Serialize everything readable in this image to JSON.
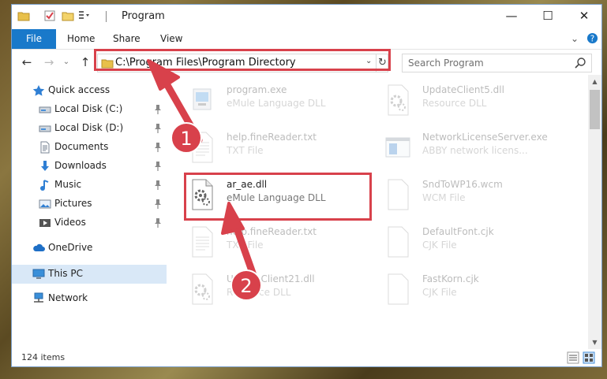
{
  "window": {
    "title": "Program",
    "controls": {
      "minimize": "—",
      "maximize": "☐",
      "close": "✕"
    }
  },
  "ribbon": {
    "tabs": [
      {
        "label": "File"
      },
      {
        "label": "Home"
      },
      {
        "label": "Share"
      },
      {
        "label": "View"
      }
    ],
    "expand_icon": "chevron-down-icon",
    "help_icon": "help-icon"
  },
  "navigation": {
    "back": "←",
    "forward": "→",
    "recent": "⌄",
    "up": "↑",
    "address": "C:\\Program Files\\Program Directory",
    "address_dropdown": "⌄",
    "refresh": "↻",
    "search_placeholder": "Search Program"
  },
  "sidebar": {
    "items": [
      {
        "label": "Quick access",
        "icon": "star-icon"
      },
      {
        "label": "Local Disk (C:)",
        "icon": "drive-icon",
        "pinned": true
      },
      {
        "label": "Local Disk (D:)",
        "icon": "drive-icon",
        "pinned": true
      },
      {
        "label": "Documents",
        "icon": "documents-icon",
        "pinned": true
      },
      {
        "label": "Downloads",
        "icon": "download-icon",
        "pinned": true
      },
      {
        "label": "Music",
        "icon": "music-icon",
        "pinned": true
      },
      {
        "label": "Pictures",
        "icon": "pictures-icon",
        "pinned": true
      },
      {
        "label": "Videos",
        "icon": "videos-icon",
        "pinned": true
      },
      {
        "label": "OneDrive",
        "icon": "cloud-icon"
      },
      {
        "label": "This PC",
        "icon": "computer-icon",
        "selected": true
      },
      {
        "label": "Network",
        "icon": "network-icon"
      }
    ]
  },
  "files": [
    {
      "name": "program.exe",
      "desc": "eMule Language DLL",
      "icon": "exe-icon"
    },
    {
      "name": "UpdateClient5.dll",
      "desc": "Resource DLL",
      "icon": "gear-file-icon"
    },
    {
      "name": "help.fineReader.txt",
      "desc": "TXT File",
      "icon": "text-file-icon"
    },
    {
      "name": "NetworkLicenseServer.exe",
      "desc": "ABBY network licens...",
      "icon": "window-file-icon"
    },
    {
      "name": "ar_ae.dll",
      "desc": "eMule Language DLL",
      "icon": "gear-file-icon",
      "highlighted": true
    },
    {
      "name": "SndToWP16.wcm",
      "desc": "WCM File",
      "icon": "blank-file-icon"
    },
    {
      "name": "help.fineReader.txt",
      "desc": "TXT File",
      "icon": "text-file-icon"
    },
    {
      "name": "DefaultFont.cjk",
      "desc": "CJK File",
      "icon": "blank-file-icon"
    },
    {
      "name": "UpdateClient21.dll",
      "desc": "Resource DLL",
      "icon": "gear-file-icon"
    },
    {
      "name": "FastKorn.cjk",
      "desc": "CJK File",
      "icon": "blank-file-icon"
    }
  ],
  "status": {
    "item_count": "124 items",
    "details_view_icon": "details-view-icon",
    "tiles_view_icon": "tiles-view-icon"
  },
  "annotations": [
    {
      "number": "1",
      "color": "#d8414b"
    },
    {
      "number": "2",
      "color": "#d8414b"
    }
  ],
  "colors": {
    "accent": "#1979ca",
    "selection": "#d9e8f7",
    "highlight_box": "#d8414b"
  }
}
